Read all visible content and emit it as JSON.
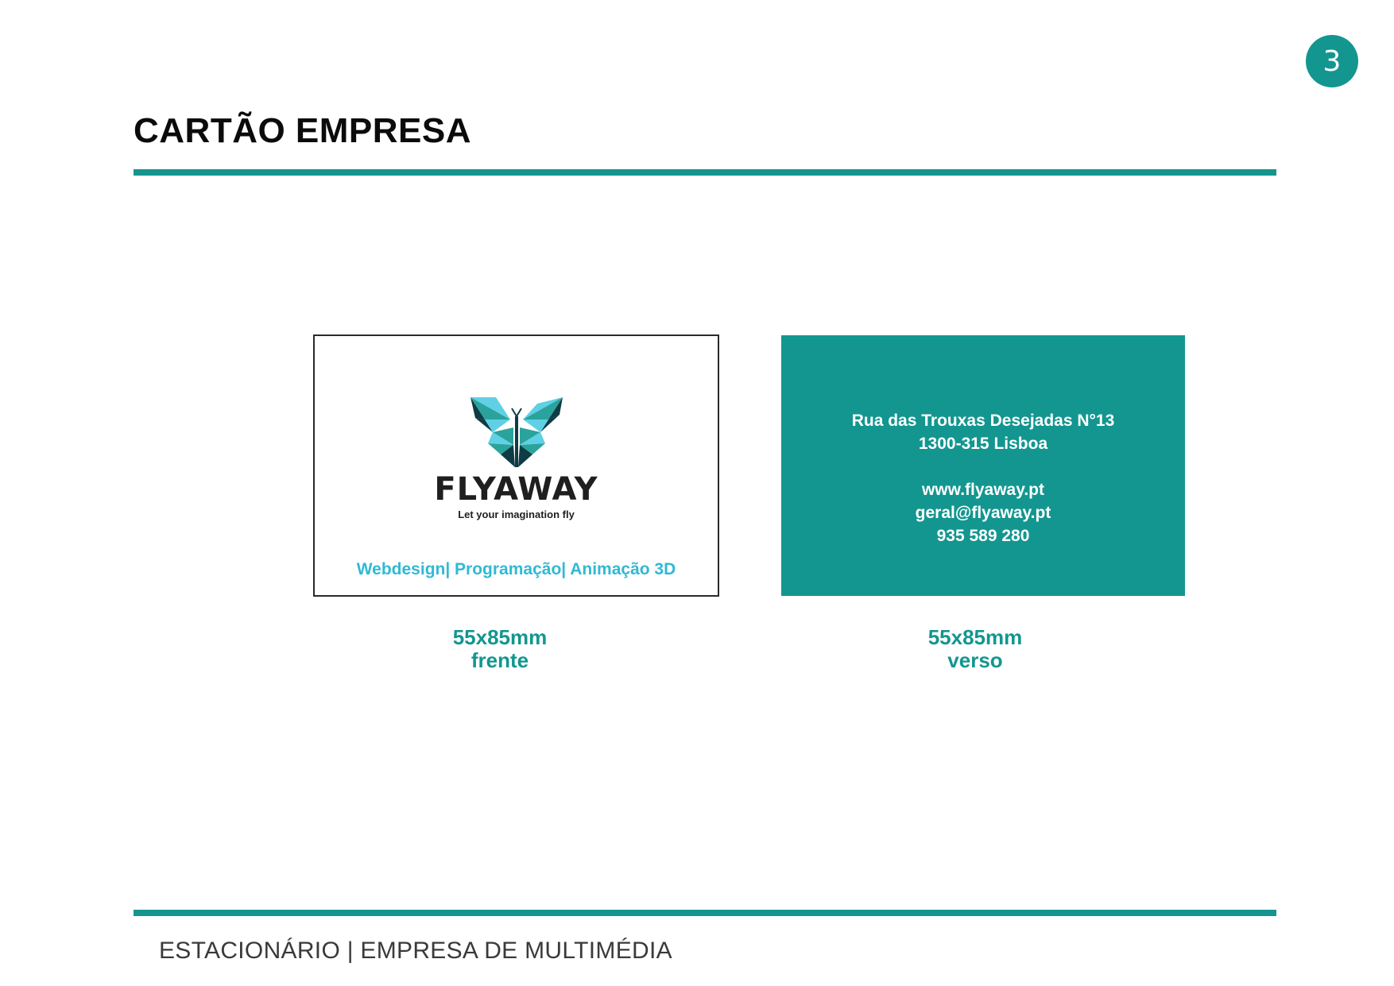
{
  "page_number": "3",
  "title": "CARTÃO EMPRESA",
  "front_card": {
    "brand_name": "FLYAWAY",
    "tagline": "Let your imagination fly",
    "services": "Webdesign| Programação| Animação 3D",
    "logo_icon": "butterfly-logo-icon"
  },
  "back_card": {
    "address_line1": "Rua das Trouxas Desejadas N°13",
    "address_line2": "1300-315 Lisboa",
    "website": "www.flyaway.pt",
    "email": "geral@flyaway.pt",
    "phone": "935 589 280"
  },
  "captions": {
    "front_size": "55x85mm",
    "front_label": "frente",
    "back_size": "55x85mm",
    "back_label": "verso"
  },
  "footer": "ESTACIONÁRIO | EMPRESA DE MULTIMÉDIA",
  "colors": {
    "accent": "#139690",
    "services_text": "#31b9d3",
    "logo_light": "#5fd0e6",
    "logo_mid": "#2aa39c",
    "logo_dark": "#0e3b44"
  }
}
